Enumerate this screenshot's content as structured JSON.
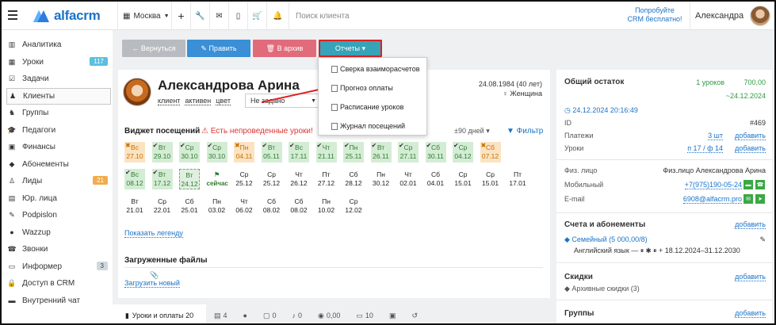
{
  "topbar": {
    "logo": "alfacrm",
    "city": "Москва",
    "search_placeholder": "Поиск клиента",
    "promo_line1": "Попробуйте",
    "promo_line2": "CRM бесплатно!",
    "user_name": "Александра"
  },
  "sidebar": {
    "items": [
      {
        "label": "Аналитика",
        "icon": "chart-icon"
      },
      {
        "label": "Уроки",
        "icon": "calendar-icon",
        "badge": "117",
        "badge_color": "#5bc0de"
      },
      {
        "label": "Задачи",
        "icon": "tasks-icon"
      },
      {
        "label": "Клиенты",
        "icon": "user-icon",
        "active": true
      },
      {
        "label": "Группы",
        "icon": "users-icon"
      },
      {
        "label": "Педагоги",
        "icon": "graduation-icon"
      },
      {
        "label": "Финансы",
        "icon": "money-icon"
      },
      {
        "label": "Абонементы",
        "icon": "tag-icon"
      },
      {
        "label": "Лиды",
        "icon": "lead-icon",
        "badge": "21",
        "badge_color": "#f0ad4e"
      },
      {
        "label": "Юр. лица",
        "icon": "building-icon"
      },
      {
        "label": "Podpislon",
        "icon": "sign-icon"
      },
      {
        "label": "Wazzup",
        "icon": "chat-icon"
      },
      {
        "label": "Звонки",
        "icon": "phone-icon"
      },
      {
        "label": "Информер",
        "icon": "informer-icon",
        "badge": "3",
        "badge_color": "#cfd8dc"
      },
      {
        "label": "Доступ в CRM",
        "icon": "lock-icon"
      },
      {
        "label": "Внутренний чат",
        "icon": "message-icon"
      }
    ]
  },
  "actions": {
    "back": "← Вернуться",
    "edit": "✎ Править",
    "archive": "🗑 В архив",
    "reports": "Отчеты ▾"
  },
  "reports_menu": [
    "Сверка взаиморасчетов",
    "Прогноз оплаты",
    "Расписание уроков",
    "Журнал посещений"
  ],
  "client": {
    "name": "Александрова Арина",
    "tags": [
      "клиент",
      "активен",
      "цвет"
    ],
    "select_value": "Не задано",
    "birth": "24.08.1984 (40 лет)",
    "gender": "♀ Женщина"
  },
  "widget": {
    "title": "Виджет посещений",
    "warning": "⚠ Есть непроведенные уроки!",
    "days": "±90 дней ▾",
    "filter": "▼ Фильтр",
    "rows": [
      [
        {
          "d": "Вс",
          "n": "27.10",
          "t": "o",
          "m": "✖"
        },
        {
          "d": "Вт",
          "n": "29.10",
          "t": "g",
          "m": "✔"
        },
        {
          "d": "Ср",
          "n": "30.10",
          "t": "g",
          "m": "✔"
        },
        {
          "d": "Ср",
          "n": "30.10",
          "t": "g",
          "m": "✔"
        },
        {
          "d": "Пн",
          "n": "04.11",
          "t": "o",
          "m": "✖"
        },
        {
          "d": "Вт",
          "n": "05.11",
          "t": "g",
          "m": "✔"
        },
        {
          "d": "Вс",
          "n": "17.11",
          "t": "g",
          "m": "✔"
        },
        {
          "d": "Чт",
          "n": "21.11",
          "t": "g",
          "m": "✔"
        },
        {
          "d": "Пн",
          "n": "25.11",
          "t": "g",
          "m": "✔"
        },
        {
          "d": "Вт",
          "n": "26.11",
          "t": "g",
          "m": "✔"
        },
        {
          "d": "Ср",
          "n": "27.11",
          "t": "g",
          "m": "✔"
        },
        {
          "d": "Сб",
          "n": "30.11",
          "t": "g",
          "m": "✔"
        },
        {
          "d": "Ср",
          "n": "04.12",
          "t": "g",
          "m": "✔"
        },
        {
          "d": "Сб",
          "n": "07.12",
          "t": "o",
          "m": "✖"
        }
      ],
      [
        {
          "d": "Вс",
          "n": "08.12",
          "t": "g",
          "m": "✔"
        },
        {
          "d": "Вт",
          "n": "17.12",
          "t": "g",
          "m": "✔"
        },
        {
          "d": "Вт",
          "n": "24.12",
          "t": "y",
          "m": ""
        },
        {
          "d": "⚑",
          "n": "сейчас",
          "t": "now",
          "m": ""
        },
        {
          "d": "Ср",
          "n": "25.12",
          "t": "w",
          "m": ""
        },
        {
          "d": "Ср",
          "n": "25.12",
          "t": "w",
          "m": ""
        },
        {
          "d": "Чт",
          "n": "26.12",
          "t": "w",
          "m": ""
        },
        {
          "d": "Пт",
          "n": "27.12",
          "t": "w",
          "m": ""
        },
        {
          "d": "Сб",
          "n": "28.12",
          "t": "w",
          "m": ""
        },
        {
          "d": "Пн",
          "n": "30.12",
          "t": "w",
          "m": ""
        },
        {
          "d": "Чт",
          "n": "02.01",
          "t": "w",
          "m": ""
        },
        {
          "d": "Сб",
          "n": "04.01",
          "t": "w",
          "m": ""
        },
        {
          "d": "Ср",
          "n": "15.01",
          "t": "w",
          "m": ""
        },
        {
          "d": "Ср",
          "n": "15.01",
          "t": "w",
          "m": ""
        },
        {
          "d": "Пт",
          "n": "17.01",
          "t": "w",
          "m": ""
        }
      ],
      [
        {
          "d": "Вт",
          "n": "21.01",
          "t": "w",
          "m": ""
        },
        {
          "d": "Ср",
          "n": "22.01",
          "t": "w",
          "m": ""
        },
        {
          "d": "Сб",
          "n": "25.01",
          "t": "w",
          "m": ""
        },
        {
          "d": "Пн",
          "n": "03.02",
          "t": "w",
          "m": ""
        },
        {
          "d": "Чт",
          "n": "06.02",
          "t": "w",
          "m": ""
        },
        {
          "d": "Сб",
          "n": "08.02",
          "t": "w",
          "m": ""
        },
        {
          "d": "Сб",
          "n": "08.02",
          "t": "w",
          "m": ""
        },
        {
          "d": "Пн",
          "n": "10.02",
          "t": "w",
          "m": ""
        },
        {
          "d": "Ср",
          "n": "12.02",
          "t": "w",
          "m": ""
        }
      ]
    ],
    "legend": "Показать легенду"
  },
  "files": {
    "title": "Загруженные файлы",
    "upload": "Загрузить новый"
  },
  "tabs": [
    "Уроки и оплаты 20",
    "4",
    "",
    "0",
    "0",
    "0,00",
    "10",
    "",
    ""
  ],
  "right": {
    "balance_title": "Общий остаток",
    "balance_lessons": "1 уроков",
    "balance_sum": "700,00",
    "balance_until": "~24.12.2024",
    "updated": "24.12.2024 20:16:49",
    "id_label": "ID",
    "id_value": "#469",
    "payments_label": "Платежи",
    "payments_value": "3 шт",
    "payments_add": "добавить",
    "lessons_label": "Уроки",
    "lessons_value": "п 17 / ф 14",
    "lessons_add": "добавить",
    "face_label": "Физ. лицо",
    "face_value": "Физ.лицо Александрова Арина",
    "mobile_label": "Мобильный",
    "mobile_value": "+7(975)190-05-24",
    "email_label": "E-mail",
    "email_value": "6908@alfacrm.pro",
    "accounts_title": "Счета и абонементы",
    "accounts_add": "добавить",
    "family": "Семейный (5 000,00/8)",
    "family_detail": "Английский язык — ⏸ ✱ ⏸ + 18.12.2024–31.12.2030",
    "discounts_title": "Скидки",
    "discounts_add": "добавить",
    "archive_discounts": "Архивные скидки (3)",
    "groups_title": "Группы",
    "groups_add": "добавить"
  }
}
